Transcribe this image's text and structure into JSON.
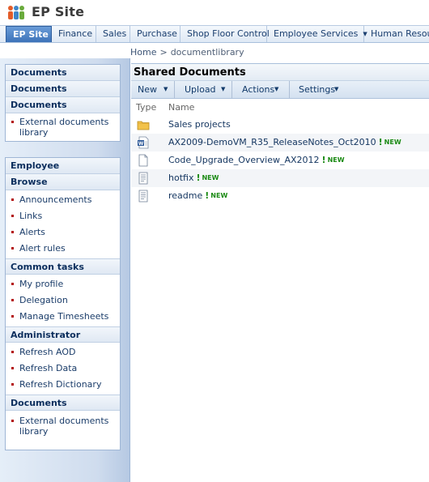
{
  "site": {
    "title": "EP Site"
  },
  "topnav": {
    "tabs": [
      {
        "label": "EP Site",
        "active": true
      },
      {
        "label": "Finance"
      },
      {
        "label": "Sales"
      },
      {
        "label": "Purchase"
      },
      {
        "label": "Shop Floor Control"
      },
      {
        "label": "Employee Services",
        "has_menu": true
      },
      {
        "label": "Human Resources"
      }
    ]
  },
  "breadcrumb": {
    "home": "Home",
    "separator": ">",
    "current": "documentlibrary"
  },
  "leftnav": {
    "top_box": {
      "headers": [
        "Documents",
        "Documents",
        "Documents"
      ],
      "items": [
        "External documents library"
      ]
    },
    "main_box": {
      "employee_header": "Employee",
      "browse_header": "Browse",
      "browse_items": [
        "Announcements",
        "Links",
        "Alerts",
        "Alert rules"
      ],
      "common_header": "Common tasks",
      "common_items": [
        "My profile",
        "Delegation",
        "Manage Timesheets"
      ],
      "admin_header": "Administrator",
      "admin_items": [
        "Refresh AOD",
        "Refresh Data",
        "Refresh Dictionary"
      ],
      "docs_header": "Documents",
      "docs_items": [
        "External documents library"
      ]
    }
  },
  "library": {
    "title": "Shared Documents",
    "toolbar": {
      "new": "New",
      "upload": "Upload",
      "actions": "Actions",
      "settings": "Settings"
    },
    "columns": {
      "type": "Type",
      "name": "Name"
    },
    "new_label": "NEW",
    "documents": [
      {
        "name": "Sales projects",
        "icon": "folder-icon",
        "is_new": false
      },
      {
        "name": "AX2009-DemoVM_R35_ReleaseNotes_Oct2010",
        "icon": "word-doc-icon",
        "is_new": true
      },
      {
        "name": "Code_Upgrade_Overview_AX2012",
        "icon": "blank-doc-icon",
        "is_new": true
      },
      {
        "name": "hotfix",
        "icon": "text-doc-icon",
        "is_new": true
      },
      {
        "name": "readme",
        "icon": "text-doc-icon",
        "is_new": true
      }
    ]
  },
  "colors": {
    "accent": "#3d73b9",
    "link": "#1b3d6a",
    "bullet": "#b31010",
    "new_badge": "#1a8a13"
  }
}
